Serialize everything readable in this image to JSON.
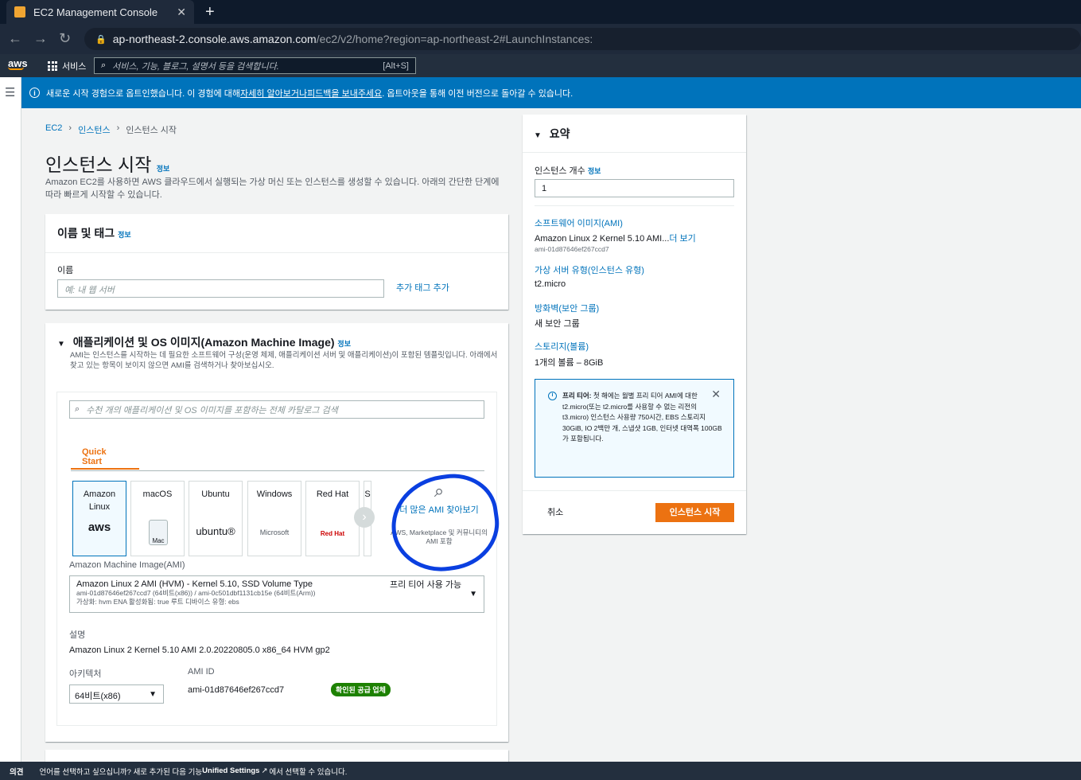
{
  "browser": {
    "tab_title": "EC2 Management Console",
    "url_host": "ap-northeast-2.console.aws.amazon.com",
    "url_path": "/ec2/v2/home?region=ap-northeast-2#LaunchInstances:"
  },
  "aws": {
    "logo": "aws",
    "services_label": "서비스",
    "search_placeholder": "서비스, 기능, 블로그, 설명서 등을 검색합니다.",
    "search_shortcut": "[Alt+S]"
  },
  "flash": {
    "text_before": "새로운 시작 경험으로 옵트인했습니다. 이 경험에 대해 ",
    "link1": "자세히 알아보거나",
    "text_mid": " ",
    "link2": "피드백을 보내주세요",
    "text_after": ". 옵트아웃을 통해 이전 버전으로 돌아갈 수 있습니다."
  },
  "breadcrumb": {
    "ec2": "EC2",
    "instances": "인스턴스",
    "current": "인스턴스 시작"
  },
  "page": {
    "title": "인스턴스 시작",
    "info": "정보",
    "description": "Amazon EC2를 사용하면 AWS 클라우드에서 실행되는 가상 머신 또는 인스턴스를 생성할 수 있습니다. 아래의 간단한 단계에 따라 빠르게 시작할 수 있습니다."
  },
  "name_tags": {
    "title": "이름 및 태그",
    "info": "정보",
    "name_label": "이름",
    "name_placeholder": "예: 내 웹 서버",
    "add_tags": "추가 태그 추가"
  },
  "ami": {
    "title": "애플리케이션 및 OS 이미지(Amazon Machine Image)",
    "info": "정보",
    "description": "AMI는 인스턴스를 시작하는 데 필요한 소프트웨어 구성(운영 체제, 애플리케이션 서버 및 애플리케이션)이 포함된 템플릿입니다. 아래에서 찾고 있는 항목이 보이지 않으면 AMI를 검색하거나 찾아보십시오.",
    "search_placeholder": "수천 개의 애플리케이션 및 OS 이미지를 포함하는 전체 카탈로그 검색",
    "quick_start_tab": "Quick Start",
    "os_options": [
      {
        "label": "Amazon Linux",
        "logo": "aws"
      },
      {
        "label": "macOS",
        "logo": "Mac"
      },
      {
        "label": "Ubuntu",
        "logo": "ubuntu®"
      },
      {
        "label": "Windows",
        "logo": "Microsoft"
      },
      {
        "label": "Red Hat",
        "logo": "Red Hat"
      },
      {
        "label": "S",
        "logo": ""
      }
    ],
    "browse_more": "더 많은 AMI 찾아보기",
    "browse_more_sub": "AWS, Marketplace 및 커뮤니티의 AMI 포함",
    "ami_label": "Amazon Machine Image(AMI)",
    "selected_name": "Amazon Linux 2 AMI (HVM) - Kernel 5.10, SSD Volume Type",
    "selected_ids": "ami-01d87646ef267ccd7 (64비트(x86)) / ami-0c501dbf1131cb15e (64비트(Arm))",
    "selected_meta": "가상화: hvm    ENA 활성화됨: true    루트 디바이스 유형: ebs",
    "free_tier": "프리 티어 사용 가능",
    "desc_label": "설명",
    "desc_value": "Amazon Linux 2 Kernel 5.10 AMI 2.0.20220805.0 x86_64 HVM gp2",
    "arch_label": "아키텍처",
    "arch_value": "64비트(x86)",
    "ami_id_label": "AMI ID",
    "ami_id_value": "ami-01d87646ef267ccd7",
    "verified_badge": "확인된 공급 업체"
  },
  "summary": {
    "title": "요약",
    "count_label": "인스턴스 개수",
    "info": "정보",
    "count_value": "1",
    "software_label": "소프트웨어 이미지(AMI)",
    "software_value": "Amazon Linux 2 Kernel 5.10 AMI...",
    "software_more": "더 보기",
    "software_id": "ami-01d87646ef267ccd7",
    "type_label": "가상 서버 유형(인스턴스 유형)",
    "type_value": "t2.micro",
    "firewall_label": "방화벽(보안 그룹)",
    "firewall_value": "새 보안 그룹",
    "storage_label": "스토리지(볼륨)",
    "storage_value": "1개의 볼륨 – 8GiB",
    "free_tier_title": "프리 티어:",
    "free_tier_text": " 첫 해에는 월별 프리 티어 AMI에 대한 t2.micro(또는 t2.micro를 사용할 수 없는 리전의 t3.micro) 인스턴스 사용량 750시간, EBS 스토리지 30GiB, IO 2백만 개, 스냅샷 1GB, 인터넷 대역폭 100GB가 포함됩니다.",
    "cancel": "취소",
    "launch": "인스턴스 시작"
  },
  "footer": {
    "feedback": "의견",
    "text_before": "언어를 선택하고 싶으십니까? 새로 추가된 다음 기능",
    "highlight": "Unified Settings",
    "text_after": "에서 선택할 수 있습니다."
  }
}
